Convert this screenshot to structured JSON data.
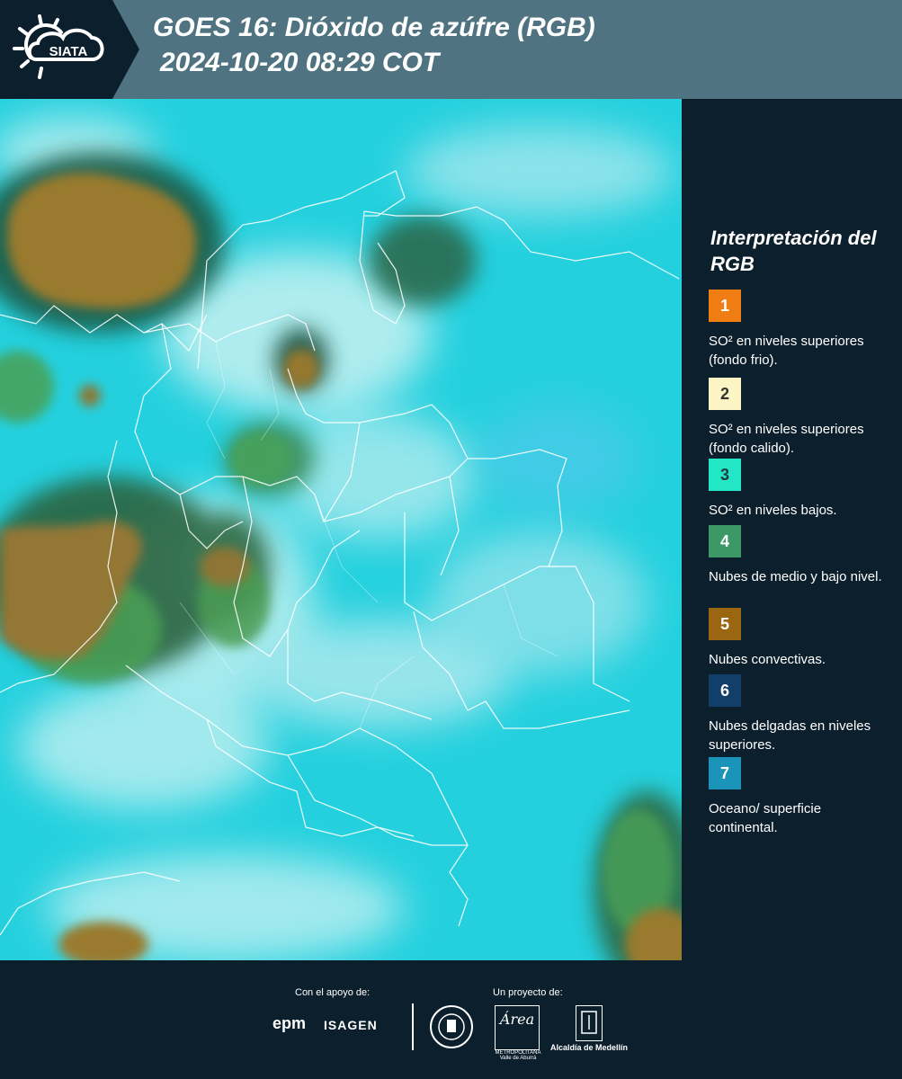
{
  "header": {
    "logo_text": "SIATA",
    "title_line1": "GOES 16: Dióxido de azúfre (RGB)",
    "title_line2": "2024-10-20 08:29 COT"
  },
  "map": {
    "description_icon": "satellite-rgb-image",
    "colors": {
      "ocean_continent": "#23d3e0",
      "thin_high_cloud": "#c9f1f1",
      "mid_low_cloud": "#3e9a4c",
      "convective": "#9b7a2c"
    }
  },
  "legend": {
    "title": "Interpretación del RGB",
    "items": [
      {
        "number": "1",
        "color": "#f07d12",
        "text": "SO² en niveles superiores (fondo frio)."
      },
      {
        "number": "2",
        "color": "#fbf4c4",
        "text": "SO² en niveles superiores (fondo calido)."
      },
      {
        "number": "3",
        "color": "#23e6c6",
        "text": "SO² en niveles bajos."
      },
      {
        "number": "4",
        "color": "#3d9868",
        "text": "Nubes de medio y bajo nivel."
      },
      {
        "number": "5",
        "color": "#9a6612",
        "text": "Nubes convectivas."
      },
      {
        "number": "6",
        "color": "#123e6a",
        "text": "Nubes delgadas en niveles superiores."
      },
      {
        "number": "7",
        "color": "#1a94b8",
        "text": "Oceano/ superficie continental."
      }
    ]
  },
  "footer": {
    "support_label": "Con el apoyo de:",
    "project_label": "Un proyecto de:",
    "epm": "epm",
    "isagen": "ISAGEN",
    "area_logo": "Área",
    "area_sub": "METROPOLITANA Valle de Aburrá",
    "alcaldia": "Alcaldía de Medellín"
  }
}
